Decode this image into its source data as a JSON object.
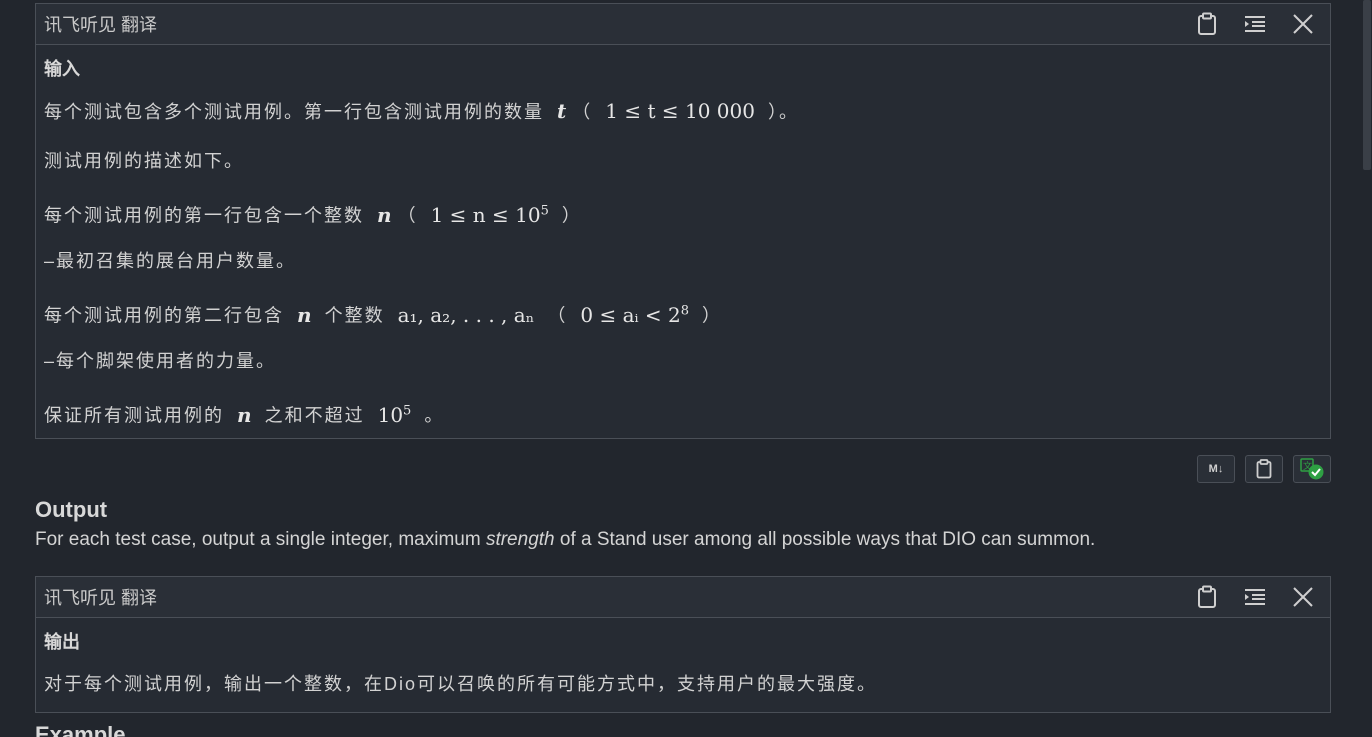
{
  "input_panel": {
    "title": "讯飞听见 翻译",
    "heading": "输入",
    "p1_a": "每个测试包含多个测试用例。第一行包含测试用例的数量",
    "p1_var": "t",
    "p1_open": "（",
    "p1_math": "1 ≤ t ≤ 10 000",
    "p1_close": "）。",
    "p2": "测试用例的描述如下。",
    "p3_a": "每个测试用例的第一行包含一个整数",
    "p3_var": "n",
    "p3_open": "（",
    "p3_math": "1 ≤ n ≤ 10",
    "p3_exp": "5",
    "p3_close": "）",
    "p4": "–最初召集的展台用户数量。",
    "p5_a": "每个测试用例的第二行包含",
    "p5_var": "n",
    "p5_b": "个整数",
    "p5_seq": "a₁, a₂, . . . , aₙ",
    "p5_open": "（",
    "p5_math": "0 ≤ aᵢ < 2",
    "p5_exp": "8",
    "p5_close": "）",
    "p6": "–每个脚架使用者的力量。",
    "p7_a": "保证所有测试用例的",
    "p7_var": "n",
    "p7_b": "之和不超过",
    "p7_math": "10",
    "p7_exp": "5",
    "p7_end": "。"
  },
  "actions": {
    "markdown_label": "M↓"
  },
  "output_section": {
    "title": "Output",
    "text_a": "For each test case, output a single integer, maximum ",
    "text_em": "strength",
    "text_b": " of a Stand user among all possible ways that DIO can summon."
  },
  "output_panel": {
    "title": "讯飞听见 翻译",
    "heading": "输出",
    "p1": "对于每个测试用例，输出一个整数，在Dio可以召唤的所有可能方式中，支持用户的最大强度。"
  },
  "next_section": {
    "title": "Example"
  },
  "icons": [
    "clipboard-icon",
    "align-icon",
    "close-icon",
    "markdown-icon",
    "translate-check-icon"
  ],
  "colors": {
    "background": "#22262d",
    "panel": "#262b33",
    "border": "#4a4f57",
    "accent_green": "#2ea043"
  }
}
